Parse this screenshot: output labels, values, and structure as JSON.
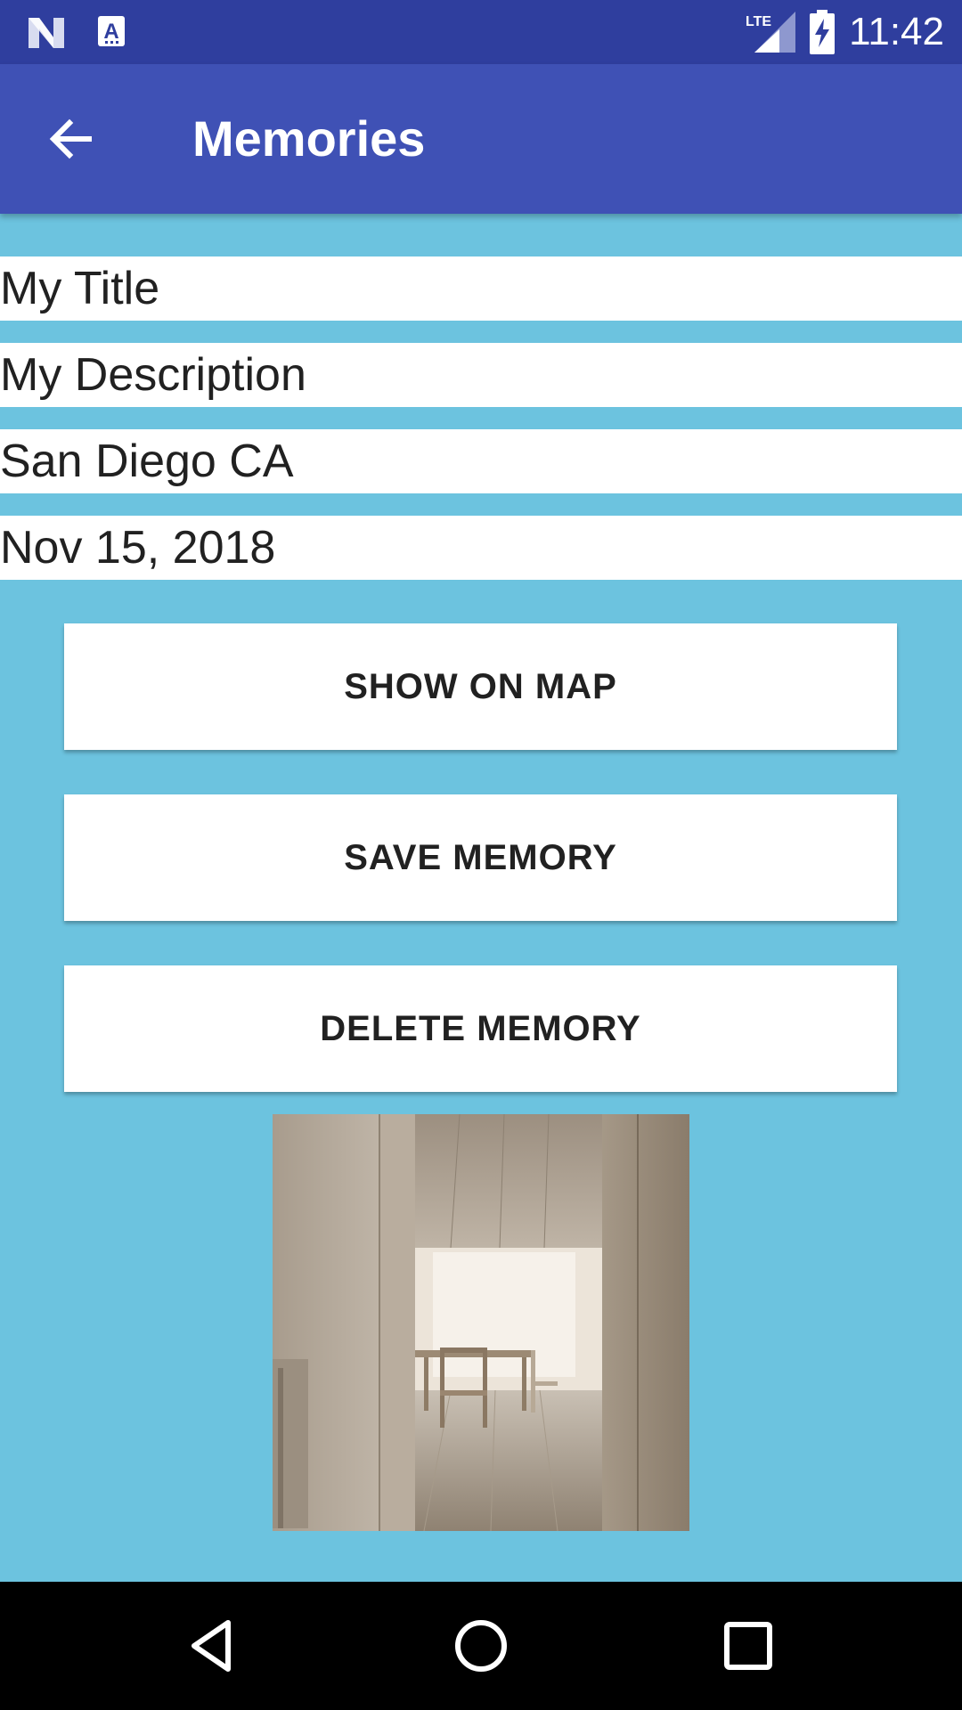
{
  "status_bar": {
    "time": "11:42",
    "icons": [
      "notification-n-icon",
      "accessibility-a-icon",
      "lte-signal-icon",
      "battery-charging-icon"
    ],
    "lte_label": "LTE"
  },
  "toolbar": {
    "title": "Memories",
    "back_icon": "arrow-back-icon",
    "color": "#3f51b5"
  },
  "form": {
    "title_value": "My Title",
    "description_value": "My Description",
    "location_value": "San Diego CA",
    "date_value": "Nov 15, 2018"
  },
  "buttons": {
    "show_on_map": "SHOW ON MAP",
    "save_memory": "SAVE MEMORY",
    "delete_memory": "DELETE MEMORY"
  },
  "photo": {
    "description_icon": "room-interior-photo"
  },
  "nav_bar": {
    "icons": [
      "nav-back-icon",
      "nav-home-icon",
      "nav-recents-icon"
    ]
  },
  "colors": {
    "background": "#6cc3df",
    "status_bar": "#2f3e9e",
    "accent": "#3f51b5"
  }
}
